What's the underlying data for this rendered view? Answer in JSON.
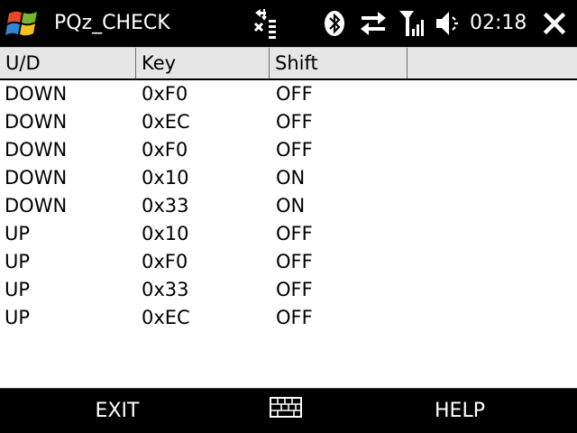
{
  "titlebar": {
    "app_title": "PQz_CHECK",
    "clock": "02:18",
    "icons": [
      "windows-start-icon",
      "data-connection-icon",
      "bluetooth-icon",
      "sync-icon",
      "signal-strength-icon",
      "volume-mute-icon",
      "close-icon"
    ]
  },
  "list": {
    "columns": [
      "U/D",
      "Key",
      "Shift",
      ""
    ],
    "rows": [
      {
        "ud": "DOWN",
        "key": "0xF0",
        "shift": "OFF"
      },
      {
        "ud": "DOWN",
        "key": "0xEC",
        "shift": "OFF"
      },
      {
        "ud": "DOWN",
        "key": "0xF0",
        "shift": "OFF"
      },
      {
        "ud": "DOWN",
        "key": "0x10",
        "shift": "ON"
      },
      {
        "ud": "DOWN",
        "key": "0x33",
        "shift": "ON"
      },
      {
        "ud": "UP",
        "key": "0x10",
        "shift": "OFF"
      },
      {
        "ud": "UP",
        "key": "0xF0",
        "shift": "OFF"
      },
      {
        "ud": "UP",
        "key": "0x33",
        "shift": "OFF"
      },
      {
        "ud": "UP",
        "key": "0xEC",
        "shift": "OFF"
      }
    ]
  },
  "menubar": {
    "left_softkey": "EXIT",
    "right_softkey": "HELP",
    "center_icon": "keyboard-icon"
  },
  "colors": {
    "bar_background": "#000000",
    "header_background": "#e6e6e6",
    "text": "#000000",
    "bar_text": "#ffffff"
  }
}
